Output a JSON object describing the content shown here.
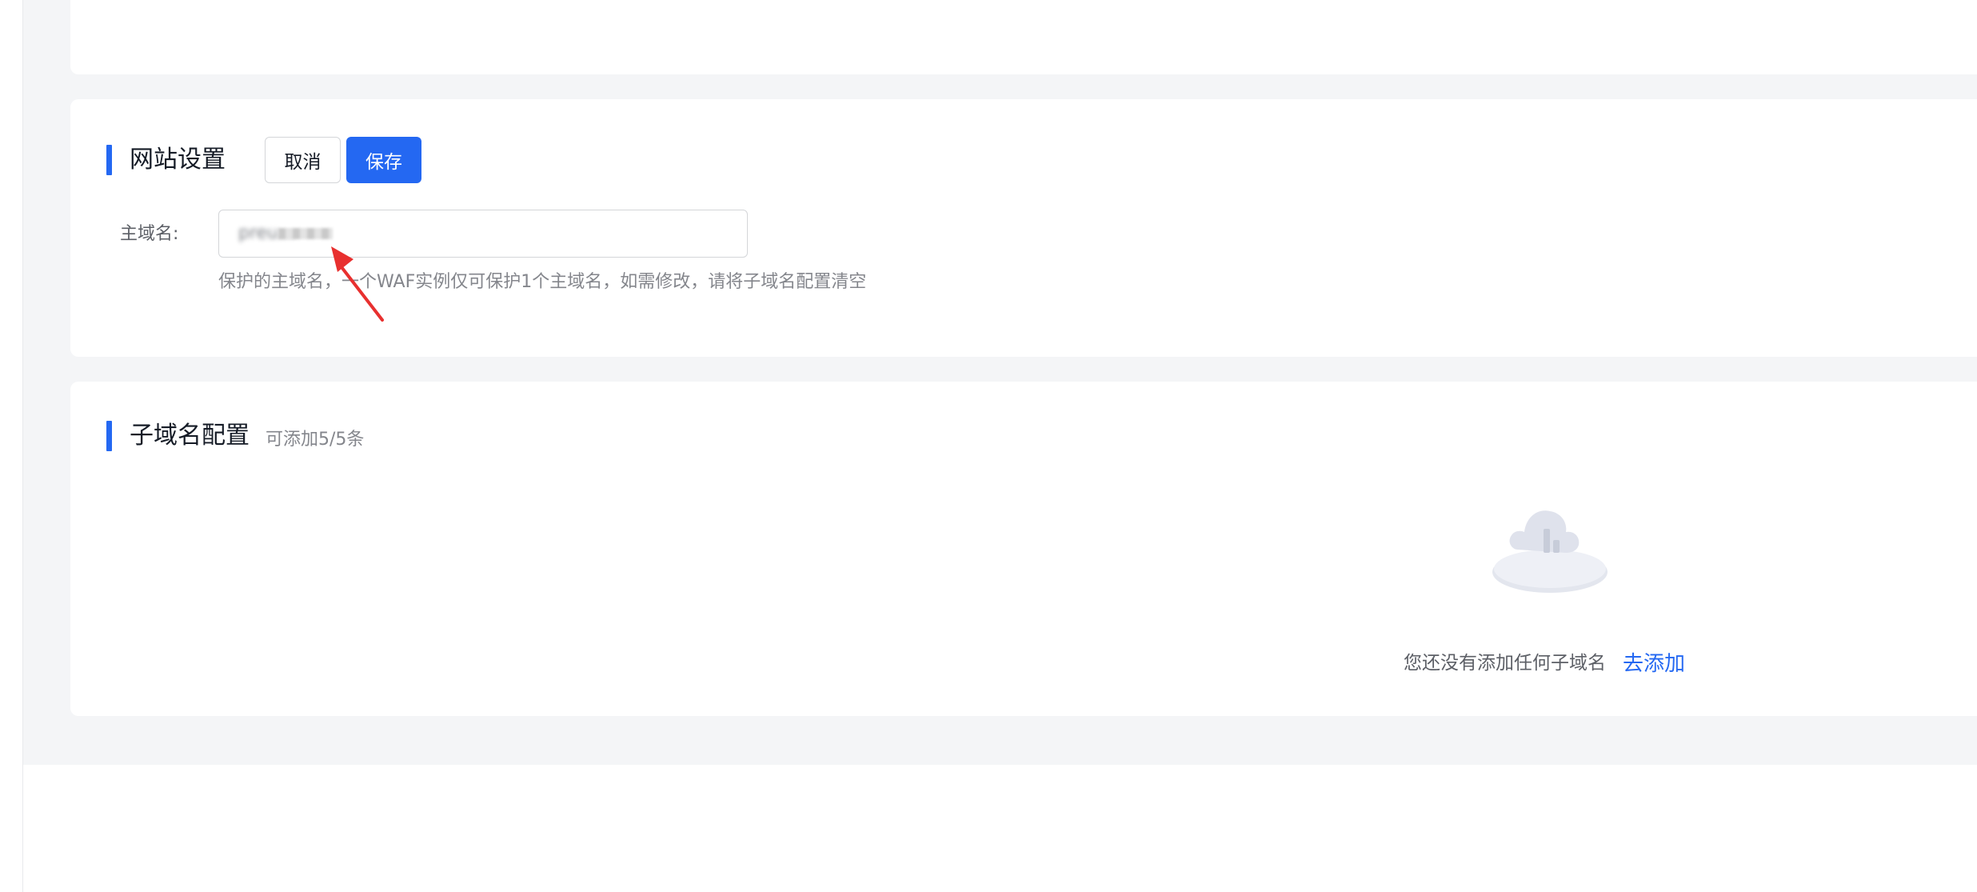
{
  "site_settings": {
    "title": "网站设置",
    "cancel_label": "取消",
    "save_label": "保存",
    "domain_label": "主域名:",
    "domain_value": "preu...",
    "domain_help": "保护的主域名，一个WAF实例仅可保护1个主域名，如需修改，请将子域名配置清空"
  },
  "subdomain_config": {
    "title": "子域名配置",
    "count_text": "可添加5/5条",
    "empty_text": "您还没有添加任何子域名",
    "add_link": "去添加"
  },
  "colors": {
    "accent": "#2468f2",
    "annotation_arrow": "#e8302f",
    "page_background": "#f4f5f7"
  },
  "icons": {
    "empty_state": "empty-cloud-icon",
    "annotation": "red-arrow-icon"
  }
}
